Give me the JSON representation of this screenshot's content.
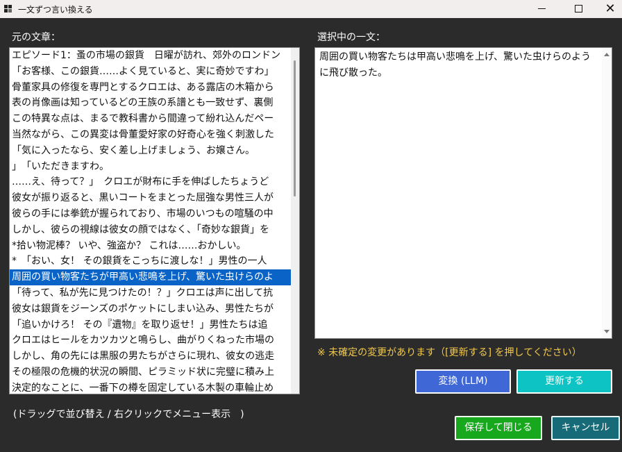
{
  "window": {
    "title": "一文ずつ言い換える",
    "close_glyph": "✕"
  },
  "left": {
    "label": "元の文章：",
    "selected_index": 14,
    "items": [
      "エピソード1：蚤の市場の銀貨　日曜が訪れ、郊外のロンドン",
      "「お客様、この銀貨……よく見ていると、実に奇妙ですわ」",
      "骨董家具の修復を専門とするクロエは、ある露店の木箱から",
      "表の肖像画は知っているどの王族の系譜とも一致せず、裏側",
      "この特異な点は、まるで教科書から間違って紛れ込んだペー",
      "当然ながら、この異変は骨董愛好家の好奇心を強く刺激した",
      "「気に入ったなら、安く差し上げましょう、お嬢さん。",
      "」　「いただきますわ。",
      "……え、待って？」　クロエが財布に手を伸ばしたちょうど",
      "彼女が振り返ると、黒いコートをまとった屈強な男性三人が",
      "彼らの手には拳銃が握られており、市場のいつもの喧騒の中",
      "しかし、彼らの視線は彼女の顔ではなく、「奇妙な銀貨」を",
      "*拾い物泥棒？ いや、強盗か？ これは……おかしい。",
      "*　「おい、女！ その銀貨をこっちに渡しな！」男性の一人",
      "周囲の買い物客たちが甲高い悲鳴を上げ、驚いた虫けらのよ",
      "「待って、私が先に見つけたの！？」クロエは声に出して抗",
      "彼女は銀貨をジーンズのポケットにしまい込み、男性たちが",
      "「追いかけろ！ その『遺物』を取り返せ！」男性たちは追",
      "クロエはヒールをカツカツと鳴らし、曲がりくねった市場の",
      "しかし、角の先には黒服の男たちがさらに現れ、彼女の逃走",
      "その極限の危機的状況の瞬間、ピラミッド状に完璧に積み上",
      "決定的なことに、一番下の樽を固定している木製の車輪止め"
    ]
  },
  "right": {
    "label": "選択中の一文：",
    "text": "周囲の買い物客たちは甲高い悲鳴を上げ、驚いた虫けらのように飛び散った。"
  },
  "warning": "※ 未確定の変更があります（[更新する] を押してください）",
  "buttons": {
    "convert": "変換 (LLM)",
    "update": "更新する",
    "save": "保存して閉じる",
    "cancel": "キャンセル"
  },
  "hint": "(ドラッグで並び替え / 右クリックでメニュー表示　)",
  "colors": {
    "background": "#2b2b2b",
    "selection": "#0a64c8",
    "warning": "#f2c94c",
    "convert": "#3f67d6",
    "update": "#0ec3c3",
    "save": "#18a81e",
    "cancel": "#176b79"
  }
}
